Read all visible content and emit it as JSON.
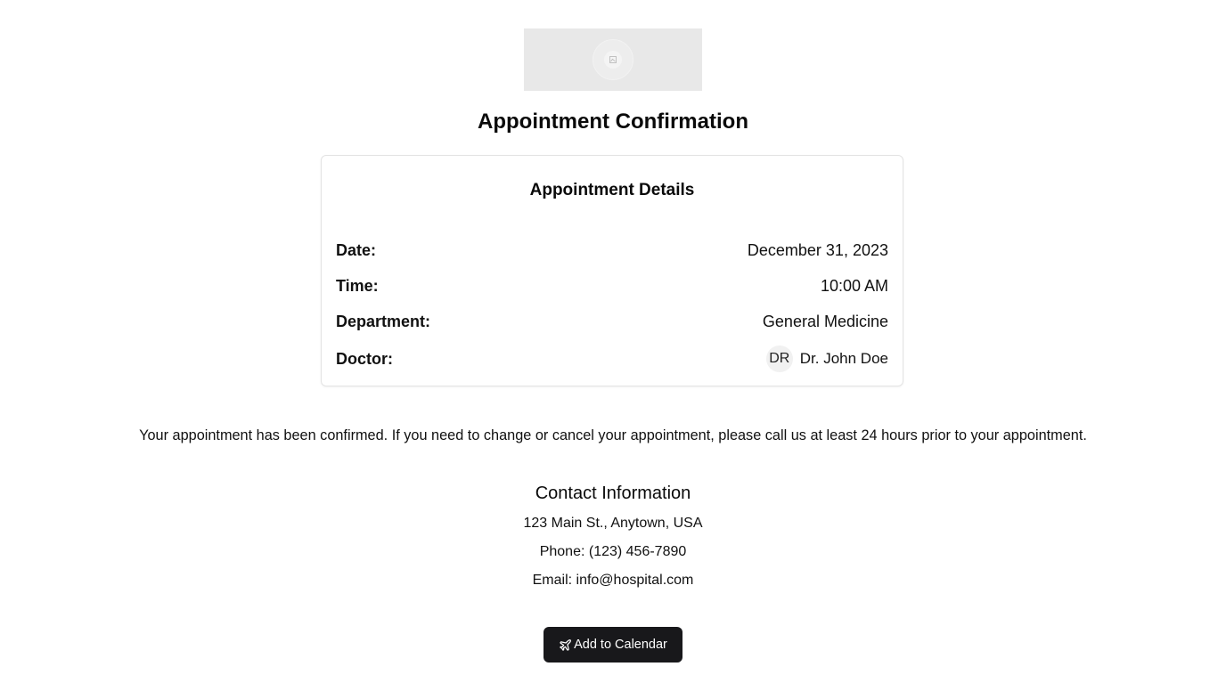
{
  "logo": {
    "icon": "image-placeholder-icon"
  },
  "page_title": "Appointment Confirmation",
  "details": {
    "title": "Appointment Details",
    "rows": [
      {
        "label": "Date:",
        "value": "December 31, 2023"
      },
      {
        "label": "Time:",
        "value": "10:00 AM"
      },
      {
        "label": "Department:",
        "value": "General Medicine"
      }
    ],
    "doctor": {
      "label": "Doctor:",
      "avatar_initials": "DR",
      "name": "Dr. John Doe"
    }
  },
  "message": "Your appointment has been confirmed. If you need to change or cancel your appointment, please call us at least 24 hours prior to your appointment.",
  "contact": {
    "title": "Contact Information",
    "address": "123 Main St., Anytown, USA",
    "phone": "Phone: (123) 456-7890",
    "email": "Email: info@hospital.com"
  },
  "cta": {
    "label": "Add to Calendar",
    "icon": "plane-icon"
  },
  "colors": {
    "button_bg": "#18181b",
    "button_text": "#ffffff",
    "card_border": "#e3e3e3",
    "logo_bg": "#e8e8e8"
  }
}
